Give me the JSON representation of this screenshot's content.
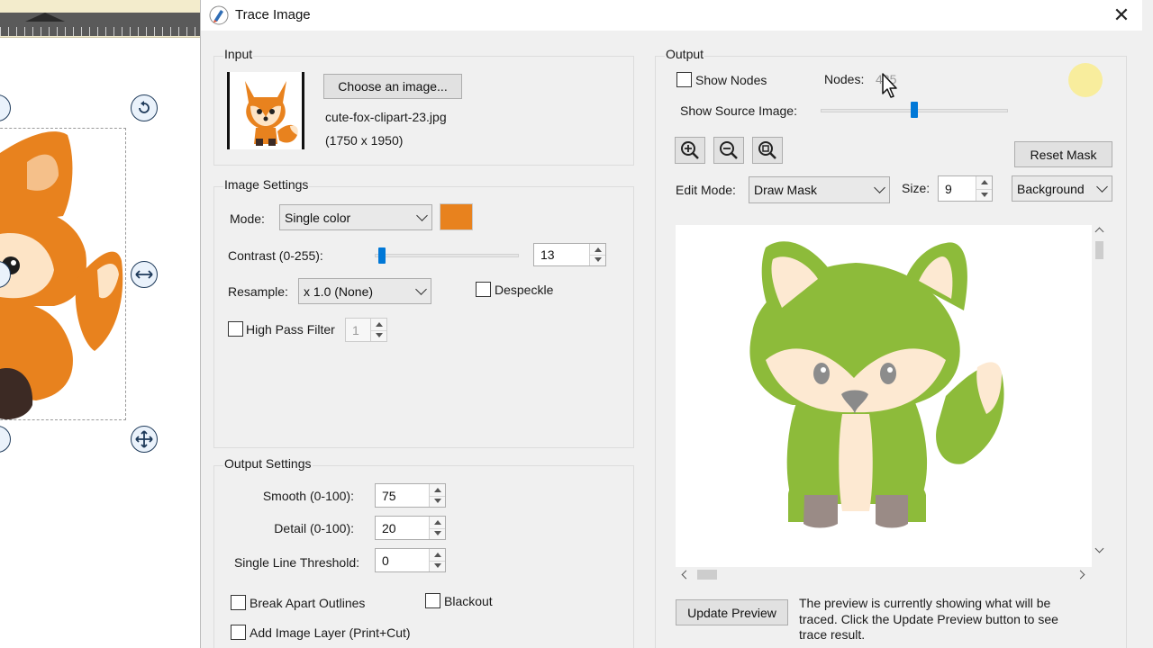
{
  "dialog": {
    "title": "Trace Image",
    "close_glyph": "✕"
  },
  "input": {
    "group_label": "Input",
    "choose_button": "Choose an image...",
    "filename": "cute-fox-clipart-23.jpg",
    "dimensions": "(1750 x 1950)"
  },
  "image_settings": {
    "group_label": "Image Settings",
    "mode_label": "Mode:",
    "mode_value": "Single color",
    "mode_color": "#e8821e",
    "contrast_label": "Contrast (0-255):",
    "contrast_value": "13",
    "contrast_fraction": 0.05,
    "resample_label": "Resample:",
    "resample_value": "x 1.0 (None)",
    "despeckle_label": "Despeckle",
    "high_pass_label": "High Pass Filter",
    "high_pass_value": "1"
  },
  "output_settings": {
    "group_label": "Output Settings",
    "smooth_label": "Smooth (0-100):",
    "smooth_value": "75",
    "detail_label": "Detail (0-100):",
    "detail_value": "20",
    "threshold_label": "Single Line Threshold:",
    "threshold_value": "0",
    "break_apart_label": "Break Apart Outlines",
    "blackout_label": "Blackout",
    "add_layer_label": "Add Image Layer (Print+Cut)"
  },
  "output": {
    "group_label": "Output",
    "show_nodes_label": "Show Nodes",
    "nodes_label": "Nodes:",
    "nodes_value": "425",
    "show_source_label": "Show Source Image:",
    "show_source_fraction": 0.5,
    "reset_mask_button": "Reset Mask",
    "edit_mode_label": "Edit Mode:",
    "edit_mode_value": "Draw Mask",
    "size_label": "Size:",
    "size_value": "9",
    "background_value": "Background",
    "update_preview_button": "Update Preview",
    "preview_note": "The preview is currently showing what will be traced. Click the Update Preview button to see trace result.",
    "trace_color": "#8dbb3a"
  },
  "icons": [
    "zoom-in-icon",
    "zoom-out-icon",
    "zoom-fit-icon",
    "rotate-icon",
    "move-icon",
    "resize-icon"
  ]
}
